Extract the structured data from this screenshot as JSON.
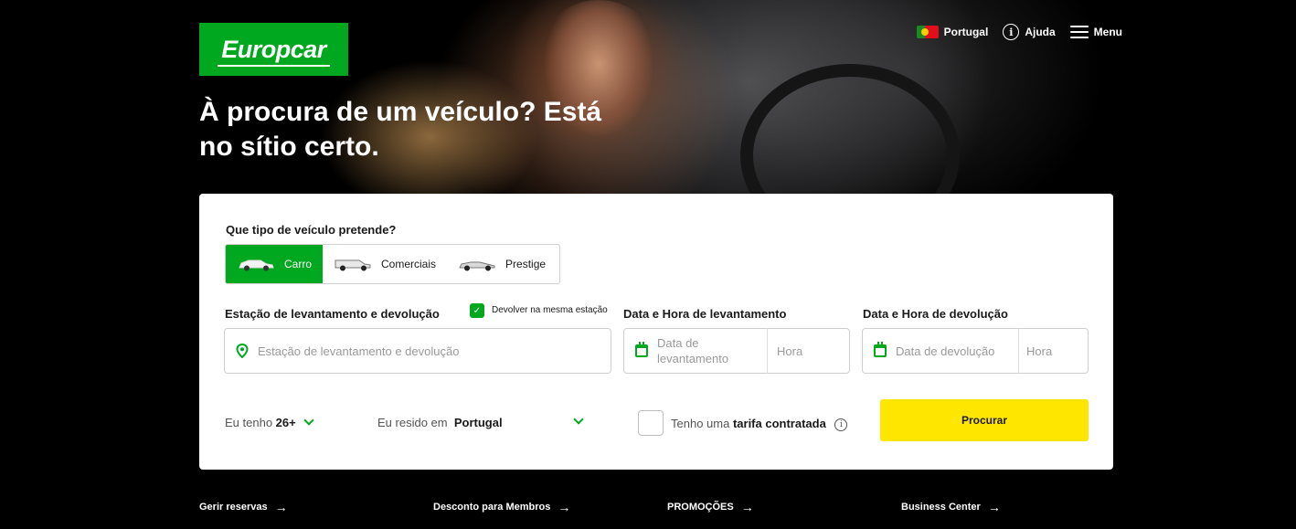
{
  "header": {
    "logo_text": "Europcar",
    "country": "Portugal",
    "help": "Ajuda",
    "menu": "Menu"
  },
  "hero": {
    "title": "À procura de um veículo? Está no sítio certo."
  },
  "search": {
    "vehicle_question": "Que tipo de veículo pretende?",
    "vehicle_types": [
      {
        "label": "Carro",
        "active": true
      },
      {
        "label": "Comerciais",
        "active": false
      },
      {
        "label": "Prestige",
        "active": false
      }
    ],
    "station_label": "Estação de levantamento e devolução",
    "same_station_label": "Devolver na mesma estação",
    "same_station_checked": true,
    "station_placeholder": "Estação de levantamento e devolução",
    "pickup_label": "Data e Hora de levantamento",
    "pickup_date_placeholder": "Data de levantamento",
    "pickup_hour_placeholder": "Hora",
    "return_label": "Data e Hora de devolução",
    "return_date_placeholder": "Data de devolução",
    "return_hour_placeholder": "Hora",
    "age_prefix": "Eu tenho",
    "age_value": "26+",
    "residence_prefix": "Eu resido em",
    "residence_value": "Portugal",
    "tarifa_prefix": "Tenho uma",
    "tarifa_bold": "tarifa contratada",
    "search_button": "Procurar"
  },
  "footer_links": [
    {
      "label": "Gerir reservas"
    },
    {
      "label": "Desconto para Membros"
    },
    {
      "label": "PROMOÇÕES"
    },
    {
      "label": "Business Center"
    }
  ],
  "colors": {
    "brand_green": "#00a81f",
    "cta_yellow": "#ffe600"
  }
}
